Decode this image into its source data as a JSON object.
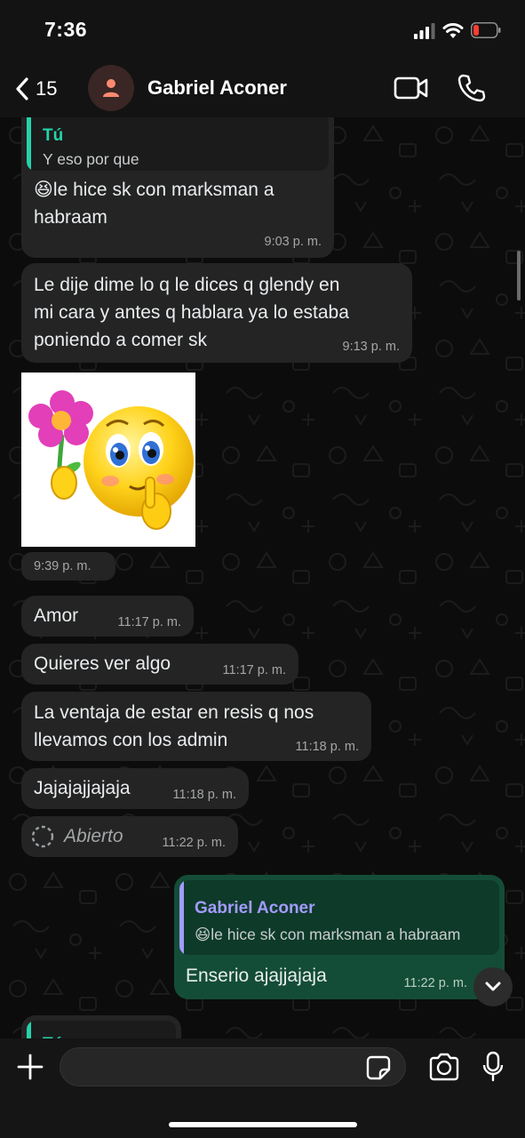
{
  "status": {
    "time": "7:36"
  },
  "header": {
    "back_count": "15",
    "contact_name": "Gabriel Aconer"
  },
  "messages": {
    "m1": {
      "quote_author": "Tú",
      "quote_text": "Y eso por que",
      "emoji": "😆",
      "text_line1": "le hice sk con marksman a",
      "text_line2": "habraam",
      "time": "9:03 p. m."
    },
    "m2": {
      "line1": "Le dije dime lo q le dices q glendy en",
      "line2": "mi cara y antes q hablara ya lo estaba",
      "line3": "poniendo a comer sk",
      "time": "9:13 p. m."
    },
    "m3": {
      "time": "9:39 p. m."
    },
    "m4": {
      "text": "Amor",
      "time": "11:17 p. m."
    },
    "m5": {
      "text": "Quieres ver algo",
      "time": "11:17 p. m."
    },
    "m6": {
      "line1": "La ventaja de estar en resis q nos",
      "line2": "llevamos con los admin",
      "time": "11:18 p. m."
    },
    "m7": {
      "text": "Jajajajjajaja",
      "time": "11:18 p. m."
    },
    "m8": {
      "text": "Abierto",
      "time": "11:22 p. m."
    },
    "m9": {
      "quote_author": "Gabriel Aconer",
      "quote_emoji": "😆",
      "quote_text": "le hice sk con marksman a habraam",
      "text": "Enserio ajajjajaja",
      "time": "11:22 p. m."
    },
    "m10": {
      "quote_author_partial": "Tú"
    }
  },
  "composer": {
    "placeholder": ""
  },
  "icons": {
    "back": "chevron-left-icon",
    "avatar": "person-icon",
    "video": "video-camera-icon",
    "call": "phone-icon",
    "plus": "plus-icon",
    "sticker": "sticker-icon",
    "camera": "camera-icon",
    "mic": "microphone-icon",
    "down": "chevron-down-icon",
    "view_once": "view-once-icon"
  },
  "colors": {
    "incoming_bubble": "#242424",
    "outgoing_bubble": "#144d37",
    "quote_self_accent": "#25d3aa",
    "quote_contact_accent": "#a39bff",
    "battery_low": "#ff3b30"
  }
}
